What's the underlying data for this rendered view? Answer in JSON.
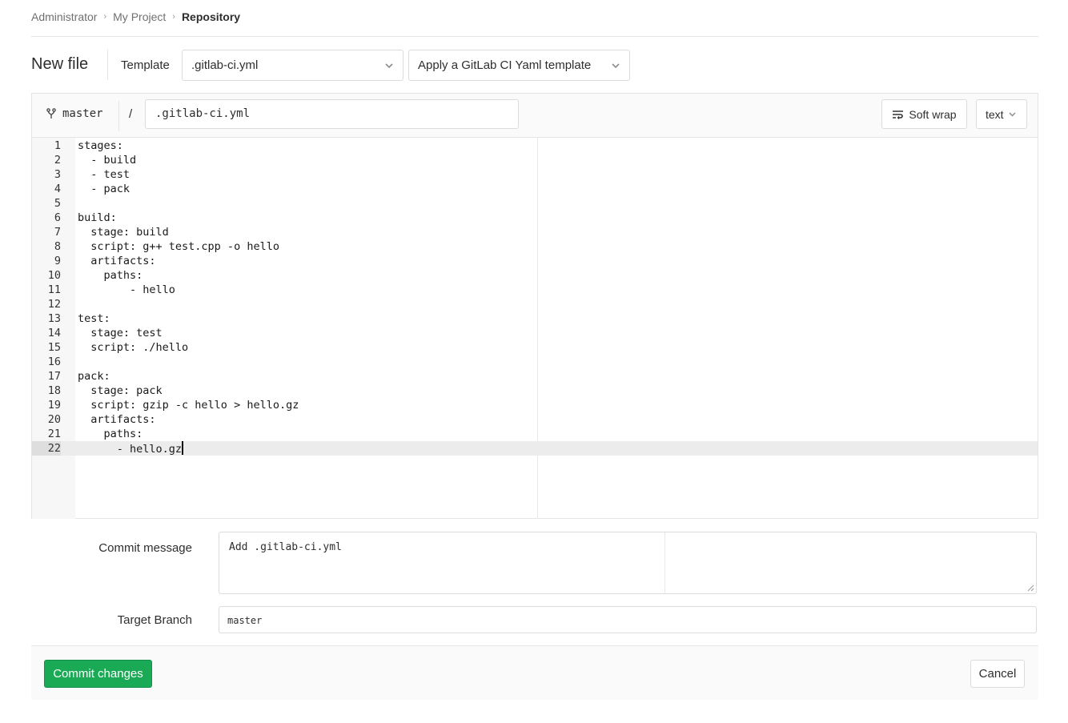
{
  "breadcrumb": {
    "items": [
      "Administrator",
      "My Project",
      "Repository"
    ]
  },
  "header": {
    "title": "New file",
    "template_label": "Template",
    "template_select": ".gitlab-ci.yml",
    "yaml_template_select": "Apply a GitLab CI Yaml template"
  },
  "editor": {
    "branch": "master",
    "path_separator": "/",
    "file_name": ".gitlab-ci.yml",
    "soft_wrap_label": "Soft wrap",
    "mode_label": "text",
    "active_line": 22,
    "lines": [
      "stages:",
      "  - build",
      "  - test",
      "  - pack",
      "",
      "build:",
      "  stage: build",
      "  script: g++ test.cpp -o hello",
      "  artifacts:",
      "    paths:",
      "        - hello",
      "",
      "test:",
      "  stage: test",
      "  script: ./hello",
      "",
      "pack:",
      "  stage: pack",
      "  script: gzip -c hello > hello.gz",
      "  artifacts:",
      "    paths:",
      "      - hello.gz"
    ]
  },
  "commit": {
    "message_label": "Commit message",
    "message_value": "Add .gitlab-ci.yml",
    "target_branch_label": "Target Branch",
    "target_branch_value": "master",
    "commit_button": "Commit changes",
    "cancel_button": "Cancel"
  },
  "colors": {
    "commit_button": "#1aaa55",
    "border": "#dcdcdc"
  },
  "icons": [
    "chevron-right-icon",
    "chevron-down-icon",
    "branch-icon",
    "soft-wrap-icon",
    "resize-grip-icon"
  ]
}
